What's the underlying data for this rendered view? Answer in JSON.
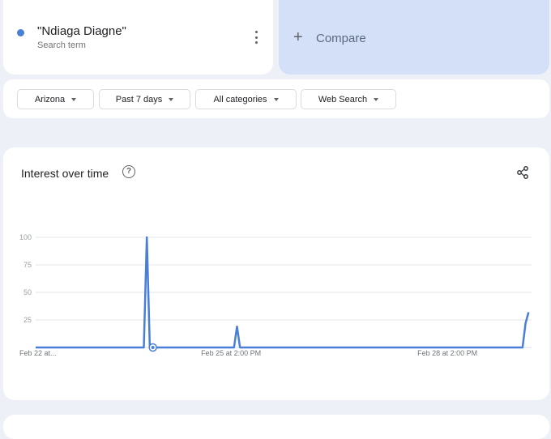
{
  "search_term": {
    "title": "\"Ndiaga Diagne\"",
    "subtitle": "Search term",
    "color": "#4a7fd8"
  },
  "compare": {
    "label": "Compare",
    "icon": "plus-icon"
  },
  "filters": {
    "region": "Arizona",
    "time": "Past 7 days",
    "category": "All categories",
    "search_type": "Web Search"
  },
  "chart_card": {
    "title": "Interest over time",
    "help_icon": "question-icon",
    "share_icon": "share-icon"
  },
  "chart_data": {
    "type": "line",
    "title": "Interest over time",
    "ylim": [
      0,
      100
    ],
    "y_ticks": [
      25,
      50,
      75,
      100
    ],
    "grid": true,
    "x_ticks": [
      {
        "x": 0,
        "label": "Feb 22 at..."
      },
      {
        "x": 65,
        "label": "Feb 25 at 2:00 PM"
      },
      {
        "x": 137,
        "label": "Feb 28 at 2:00 PM"
      }
    ],
    "x_range": [
      0,
      165
    ],
    "series": [
      {
        "color": "#4a7fd8",
        "points": [
          [
            0,
            0
          ],
          [
            36,
            0
          ],
          [
            37,
            100
          ],
          [
            38,
            0
          ],
          [
            39,
            0
          ],
          [
            66,
            0
          ],
          [
            67,
            19
          ],
          [
            68,
            0
          ],
          [
            162,
            0
          ],
          [
            163,
            22
          ],
          [
            164,
            32
          ]
        ]
      }
    ],
    "hover_point": [
      39,
      0
    ]
  }
}
